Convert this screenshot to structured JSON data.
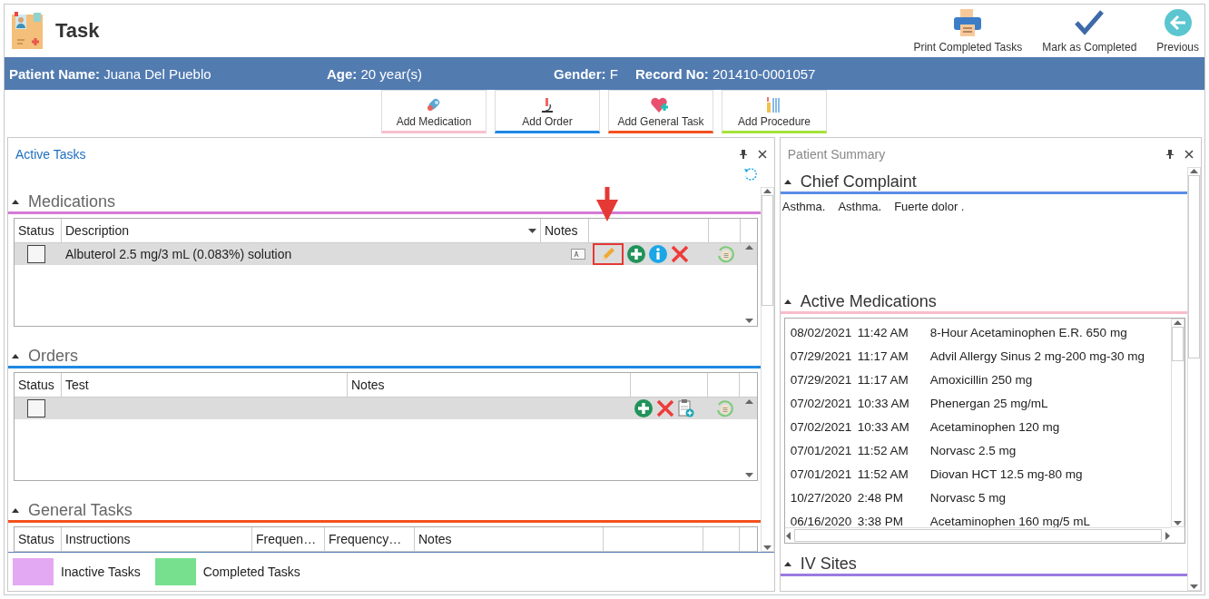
{
  "window": {
    "title": "Task"
  },
  "toolbar": [
    {
      "label": "Print Completed Tasks",
      "kind": "print"
    },
    {
      "label": "Mark as Completed",
      "kind": "check"
    },
    {
      "label": "Previous",
      "kind": "back"
    }
  ],
  "patient": [
    {
      "label": "Patient Name:",
      "value": "Juana Del Pueblo"
    },
    {
      "label": "Age:",
      "value": "20 year(s)"
    },
    {
      "label": "Gender:",
      "value": "F"
    },
    {
      "label": "Record No:",
      "value": "201410-0001057"
    }
  ],
  "add_buttons": [
    {
      "label": "Add Medication",
      "kind": "medication",
      "color": "#f6c1cf"
    },
    {
      "label": "Add Order",
      "kind": "order",
      "color": "#1e88e5"
    },
    {
      "label": "Add General Task",
      "kind": "general",
      "color": "#f4511e"
    },
    {
      "label": "Add Procedure",
      "kind": "procedure",
      "color": "#a6e23a"
    }
  ],
  "active_tasks": {
    "title": "Active Tasks",
    "sections": [
      {
        "title": "Medications",
        "kind": "medications",
        "color": "#d67ad6",
        "columns": [
          "Status",
          "Description",
          "Notes"
        ],
        "rows": [
          {
            "checked": false,
            "text": "Albuterol 2.5 mg/3 mL (0.083%) solution",
            "actions": [
              {
                "kind": "edit",
                "highlighted": true
              },
              {
                "kind": "add",
                "highlighted": false
              },
              {
                "kind": "info",
                "highlighted": false
              },
              {
                "kind": "delete",
                "highlighted": false
              }
            ]
          }
        ]
      },
      {
        "title": "Orders",
        "kind": "orders",
        "color": "#1e88e5",
        "columns": [
          "Status",
          "Test",
          "Notes"
        ],
        "rows": [
          {
            "checked": false,
            "text": "",
            "actions": [
              {
                "kind": "add",
                "highlighted": false
              },
              {
                "kind": "delete",
                "highlighted": false
              },
              {
                "kind": "clipboard",
                "highlighted": false
              }
            ]
          }
        ]
      },
      {
        "title": "General Tasks",
        "kind": "general",
        "color": "#f4511e",
        "columns": [
          "Status",
          "Instructions",
          "Frequen…",
          "Frequency…",
          "Notes"
        ]
      }
    ]
  },
  "legend": [
    {
      "label": "Inactive Tasks",
      "color": "#e4a9f3"
    },
    {
      "label": "Completed Tasks",
      "color": "#77e08f"
    }
  ],
  "patient_summary": {
    "title": "Patient Summary",
    "chief_complaint": {
      "title": "Chief Complaint",
      "color": "#5b8ee6",
      "items": [
        "Asthma.",
        "Asthma.",
        "Fuerte dolor ."
      ]
    },
    "active_medications": {
      "title": "Active Medications",
      "color": "#f7bcc8",
      "rows": [
        {
          "date": "08/02/2021",
          "time": "11:42 AM",
          "drug": "8-Hour Acetaminophen E.R. 650 mg"
        },
        {
          "date": "07/29/2021",
          "time": "11:17 AM",
          "drug": "Advil Allergy Sinus 2 mg-200 mg-30 mg"
        },
        {
          "date": "07/29/2021",
          "time": "11:17 AM",
          "drug": "Amoxicillin 250 mg"
        },
        {
          "date": "07/02/2021",
          "time": "10:33 AM",
          "drug": "Phenergan 25 mg/mL"
        },
        {
          "date": "07/02/2021",
          "time": "10:33 AM",
          "drug": "Acetaminophen 120 mg"
        },
        {
          "date": "07/01/2021",
          "time": "11:52 AM",
          "drug": "Norvasc 2.5 mg"
        },
        {
          "date": "07/01/2021",
          "time": "11:52 AM",
          "drug": "Diovan HCT 12.5 mg-80 mg"
        },
        {
          "date": "10/27/2020",
          "time": "2:48 PM",
          "drug": "Norvasc 5 mg"
        },
        {
          "date": "06/16/2020",
          "time": "3:38 PM",
          "drug": "Acetaminophen 160 mg/5 mL"
        }
      ]
    },
    "iv_sites": {
      "title": "IV Sites",
      "color": "#9b7be0"
    }
  }
}
